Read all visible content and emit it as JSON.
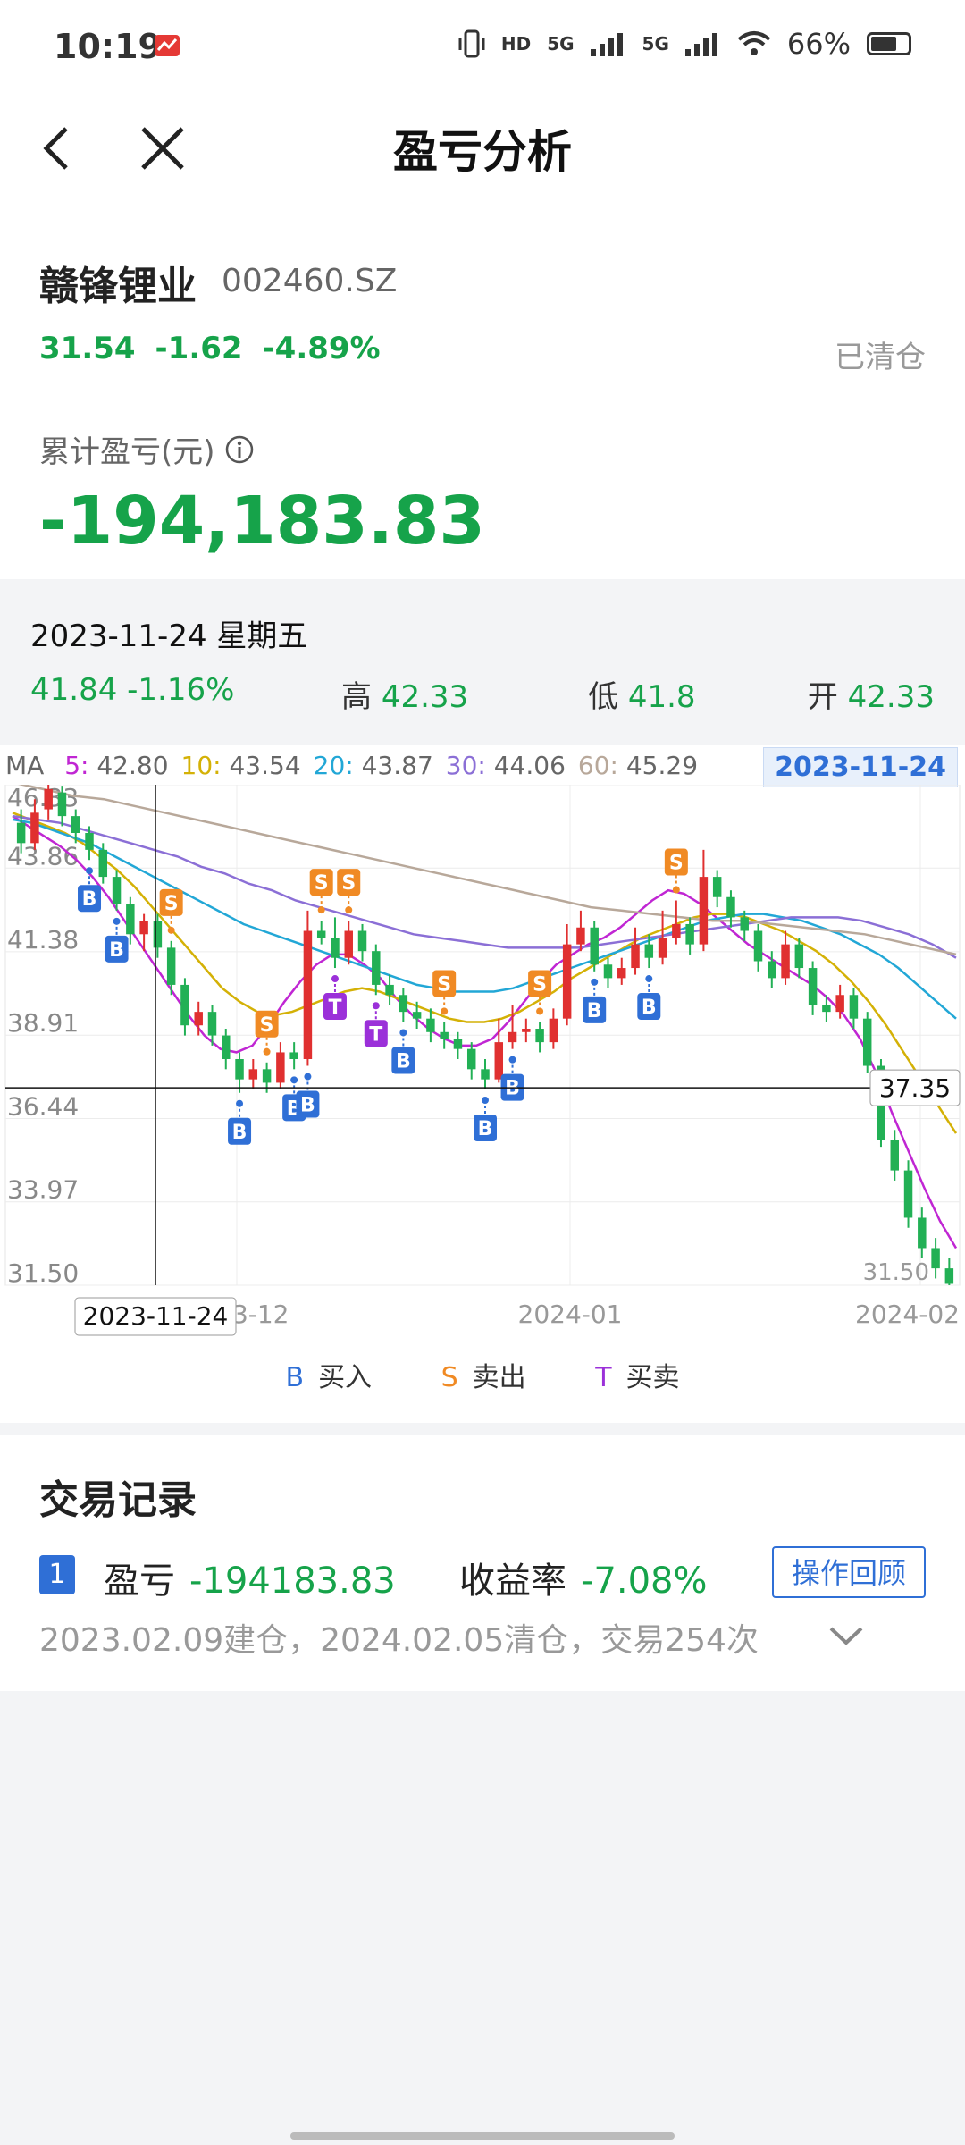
{
  "status": {
    "time": "10:19",
    "indicators": [
      "vibrate-icon",
      "HD",
      "5G",
      "5G",
      "wifi-icon"
    ],
    "battery": "66%",
    "battery_level": 0.66
  },
  "nav": {
    "title": "盈亏分析"
  },
  "stock": {
    "name": "赣锋锂业",
    "code": "002460.SZ",
    "price": "31.54",
    "change": "-1.62",
    "change_pct": "-4.89%",
    "status": "已清仓",
    "pnl_label": "累计盈亏(元)",
    "pnl_value": "-194,183.83"
  },
  "day": {
    "date": "2023-11-24 星期五",
    "close": "41.84",
    "change_pct": "-1.16%",
    "high_label": "高",
    "high": "42.33",
    "low_label": "低",
    "low": "41.8",
    "open_label": "开",
    "open": "42.33"
  },
  "ma": {
    "label": "MA",
    "items": [
      {
        "key": "5:",
        "value": "42.80",
        "color": "#c026d3"
      },
      {
        "key": "10:",
        "value": "43.54",
        "color": "#d4b106"
      },
      {
        "key": "20:",
        "value": "43.87",
        "color": "#22a7d6"
      },
      {
        "key": "30:",
        "value": "44.06",
        "color": "#8b6fd6"
      },
      {
        "key": "60:",
        "value": "45.29",
        "color": "#b8a89a"
      }
    ],
    "date_chip": "2023-11-24"
  },
  "chart_data": {
    "type": "candlestick",
    "y_ticks": [
      "46.33",
      "43.86",
      "41.38",
      "38.91",
      "36.44",
      "33.97",
      "31.50"
    ],
    "y_range": [
      31.5,
      46.33
    ],
    "x_labels": [
      "2023-11-24",
      "2023-12",
      "2024-01",
      "2024-02"
    ],
    "crosshair_value": "37.35",
    "min_label": "31.50",
    "colors": {
      "up": "#e03030",
      "down": "#22b055",
      "buy": "#2f6fd6",
      "sell": "#f08a24",
      "trade": "#9b30d9"
    },
    "candles": [
      [
        45.2,
        44.6,
        45.6,
        44.3
      ],
      [
        44.6,
        45.5,
        45.9,
        44.4
      ],
      [
        45.6,
        46.2,
        46.6,
        45.3
      ],
      [
        46.1,
        45.4,
        46.3,
        45.1
      ],
      [
        45.4,
        44.9,
        45.6,
        44.6
      ],
      [
        44.9,
        44.4,
        45.1,
        44.1
      ],
      [
        44.4,
        43.6,
        44.6,
        43.4
      ],
      [
        43.6,
        42.8,
        43.8,
        42.6
      ],
      [
        42.8,
        41.9,
        43.0,
        41.6
      ],
      [
        41.9,
        42.3,
        42.5,
        41.4
      ],
      [
        42.3,
        41.5,
        42.5,
        41.2
      ],
      [
        41.5,
        40.4,
        41.7,
        40.1
      ],
      [
        40.4,
        39.2,
        40.6,
        38.9
      ],
      [
        39.2,
        39.6,
        39.9,
        38.9
      ],
      [
        39.6,
        38.9,
        39.8,
        38.6
      ],
      [
        38.9,
        38.2,
        39.1,
        37.9
      ],
      [
        38.2,
        37.6,
        38.4,
        37.2
      ],
      [
        37.6,
        37.9,
        38.2,
        37.3
      ],
      [
        37.9,
        37.5,
        38.1,
        37.2
      ],
      [
        37.5,
        38.4,
        38.7,
        37.3
      ],
      [
        38.4,
        38.2,
        38.7,
        37.9
      ],
      [
        38.2,
        42.0,
        42.6,
        38.0
      ],
      [
        42.0,
        41.8,
        42.3,
        41.6
      ],
      [
        41.8,
        41.2,
        42.4,
        40.9
      ],
      [
        41.2,
        42.0,
        42.3,
        41.0
      ],
      [
        42.0,
        41.4,
        42.2,
        41.1
      ],
      [
        41.4,
        40.4,
        41.6,
        40.1
      ],
      [
        40.4,
        40.1,
        40.7,
        39.8
      ],
      [
        40.1,
        39.6,
        40.3,
        39.3
      ],
      [
        39.6,
        39.4,
        39.9,
        39.1
      ],
      [
        39.4,
        39.0,
        39.7,
        38.7
      ],
      [
        39.0,
        38.8,
        39.3,
        38.5
      ],
      [
        38.8,
        38.5,
        39.0,
        38.2
      ],
      [
        38.5,
        37.9,
        38.7,
        37.6
      ],
      [
        37.9,
        37.6,
        38.2,
        37.3
      ],
      [
        37.6,
        38.7,
        39.4,
        37.5
      ],
      [
        38.7,
        39.0,
        39.8,
        38.5
      ],
      [
        39.0,
        39.1,
        39.4,
        38.7
      ],
      [
        39.1,
        38.7,
        39.3,
        38.4
      ],
      [
        38.7,
        39.4,
        39.7,
        38.5
      ],
      [
        39.4,
        41.6,
        42.2,
        39.2
      ],
      [
        41.6,
        42.1,
        42.6,
        41.4
      ],
      [
        42.1,
        41.0,
        42.3,
        40.8
      ],
      [
        41.0,
        40.6,
        41.2,
        40.3
      ],
      [
        40.6,
        40.9,
        41.2,
        40.4
      ],
      [
        40.9,
        41.6,
        42.1,
        40.7
      ],
      [
        41.6,
        41.2,
        41.9,
        40.9
      ],
      [
        41.2,
        41.8,
        42.6,
        41.0
      ],
      [
        41.8,
        42.2,
        42.9,
        41.6
      ],
      [
        42.2,
        41.6,
        42.4,
        41.3
      ],
      [
        41.6,
        43.6,
        44.4,
        41.4
      ],
      [
        43.6,
        43.0,
        43.8,
        42.7
      ],
      [
        43.0,
        42.4,
        43.2,
        42.1
      ],
      [
        42.4,
        42.0,
        42.6,
        41.7
      ],
      [
        42.0,
        41.1,
        42.2,
        40.8
      ],
      [
        41.1,
        40.6,
        41.4,
        40.3
      ],
      [
        40.6,
        41.6,
        42.0,
        40.4
      ],
      [
        41.6,
        40.9,
        41.8,
        40.6
      ],
      [
        40.9,
        39.8,
        41.1,
        39.5
      ],
      [
        39.8,
        39.6,
        40.1,
        39.3
      ],
      [
        39.6,
        40.1,
        40.4,
        39.4
      ],
      [
        40.1,
        39.4,
        40.3,
        39.1
      ],
      [
        39.4,
        38.0,
        39.6,
        37.8
      ],
      [
        38.0,
        35.8,
        38.2,
        35.6
      ],
      [
        35.8,
        34.9,
        36.1,
        34.6
      ],
      [
        34.9,
        33.5,
        35.2,
        33.2
      ],
      [
        33.5,
        32.6,
        33.8,
        32.3
      ],
      [
        32.6,
        32.0,
        32.9,
        31.7
      ],
      [
        32.0,
        31.54,
        32.3,
        31.5
      ]
    ],
    "markers": [
      {
        "i": 5,
        "t": "B"
      },
      {
        "i": 7,
        "t": "B"
      },
      {
        "i": 11,
        "t": "S"
      },
      {
        "i": 16,
        "t": "B"
      },
      {
        "i": 18,
        "t": "S"
      },
      {
        "i": 20,
        "t": "B"
      },
      {
        "i": 21,
        "t": "B"
      },
      {
        "i": 22,
        "t": "S"
      },
      {
        "i": 23,
        "t": "T"
      },
      {
        "i": 24,
        "t": "S"
      },
      {
        "i": 26,
        "t": "T"
      },
      {
        "i": 28,
        "t": "B"
      },
      {
        "i": 31,
        "t": "S"
      },
      {
        "i": 34,
        "t": "B"
      },
      {
        "i": 36,
        "t": "B"
      },
      {
        "i": 38,
        "t": "S"
      },
      {
        "i": 42,
        "t": "B"
      },
      {
        "i": 46,
        "t": "B"
      },
      {
        "i": 48,
        "t": "S"
      }
    ],
    "ma_series": [
      {
        "name": "5",
        "values": [
          45.4,
          45.1,
          44.8,
          44.5,
          44.1,
          43.6,
          43.0,
          42.3,
          41.6,
          40.9,
          40.2,
          39.5,
          38.9,
          38.5,
          38.4,
          38.6,
          39.2,
          39.9,
          40.5,
          41.0,
          41.3,
          41.3,
          41.0,
          40.6,
          40.0,
          39.5,
          39.1,
          38.8,
          38.6,
          38.6,
          38.8,
          39.3,
          39.9,
          40.5,
          41.0,
          41.3,
          41.6,
          41.8,
          42.1,
          42.5,
          42.9,
          43.2,
          43.1,
          42.8,
          42.4,
          42.0,
          41.6,
          41.3,
          41.0,
          40.7,
          40.4,
          40.0,
          39.5,
          38.8,
          37.8,
          36.6,
          35.5,
          34.4,
          33.4,
          32.6
        ]
      },
      {
        "name": "10",
        "values": [
          45.5,
          45.3,
          45.1,
          44.9,
          44.6,
          44.2,
          43.8,
          43.3,
          42.7,
          42.1,
          41.5,
          40.9,
          40.3,
          39.9,
          39.6,
          39.5,
          39.6,
          39.8,
          40.0,
          40.2,
          40.3,
          40.2,
          40.0,
          39.8,
          39.6,
          39.4,
          39.3,
          39.3,
          39.4,
          39.6,
          39.9,
          40.2,
          40.6,
          40.9,
          41.2,
          41.5,
          41.8,
          42.0,
          42.2,
          42.4,
          42.5,
          42.5,
          42.4,
          42.2,
          42.0,
          41.7,
          41.4,
          41.0,
          40.5,
          39.9,
          39.2,
          38.4,
          37.6,
          36.8,
          36.0
        ]
      },
      {
        "name": "20",
        "values": [
          45.3,
          45.2,
          45.0,
          44.8,
          44.6,
          44.3,
          44.0,
          43.7,
          43.4,
          43.1,
          42.8,
          42.5,
          42.2,
          42.0,
          41.8,
          41.6,
          41.4,
          41.2,
          41.0,
          40.8,
          40.6,
          40.4,
          40.3,
          40.2,
          40.2,
          40.2,
          40.3,
          40.5,
          40.7,
          40.9,
          41.1,
          41.3,
          41.5,
          41.7,
          41.9,
          42.1,
          42.3,
          42.4,
          42.5,
          42.5,
          42.4,
          42.3,
          42.1,
          41.9,
          41.6,
          41.3,
          40.9,
          40.4,
          39.9,
          39.4
        ]
      },
      {
        "name": "30",
        "values": [
          45.4,
          45.3,
          45.2,
          45.0,
          44.8,
          44.6,
          44.4,
          44.2,
          43.9,
          43.7,
          43.4,
          43.2,
          42.9,
          42.7,
          42.5,
          42.3,
          42.1,
          41.9,
          41.8,
          41.7,
          41.6,
          41.5,
          41.5,
          41.5,
          41.5,
          41.6,
          41.7,
          41.8,
          41.9,
          42.0,
          42.1,
          42.2,
          42.3,
          42.4,
          42.4,
          42.4,
          42.3,
          42.1,
          41.9,
          41.6,
          41.2
        ]
      },
      {
        "name": "60",
        "values": [
          46.4,
          46.2,
          46.0,
          45.9,
          45.7,
          45.5,
          45.3,
          45.1,
          44.9,
          44.7,
          44.5,
          44.3,
          44.1,
          43.9,
          43.7,
          43.5,
          43.3,
          43.1,
          42.9,
          42.7,
          42.6,
          42.5,
          42.4,
          42.3,
          42.3,
          42.2,
          42.1,
          42.0,
          41.9,
          41.7,
          41.5,
          41.3
        ]
      }
    ]
  },
  "legend": {
    "buy_key": "B",
    "buy_label": "买入",
    "sell_key": "S",
    "sell_label": "卖出",
    "trade_key": "T",
    "trade_label": "买卖"
  },
  "records": {
    "title": "交易记录",
    "index": "1",
    "pnl_label": "盈亏",
    "pnl_value": "-194183.83",
    "yield_label": "收益率",
    "yield_value": "-7.08%",
    "review_button": "操作回顾",
    "detail": "2023.02.09建仓，2024.02.05清仓，交易254次"
  }
}
